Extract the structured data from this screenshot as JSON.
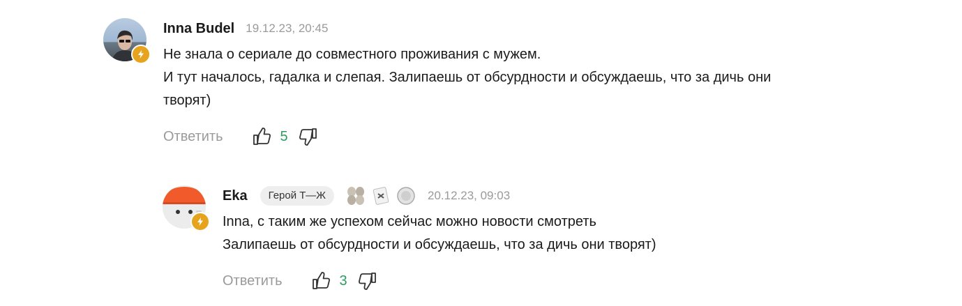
{
  "comments": [
    {
      "author": "Inna Budel",
      "date": "19.12.23, 20:45",
      "lines": [
        "Не знала о сериале до совместного проживания с мужем.",
        "И тут началось, гадалка и слепая. Залипаешь от обсурдности и обсуждаешь, что за дичь они",
        "творят)"
      ],
      "reply_label": "Ответить",
      "likes": "5"
    },
    {
      "author": "Eka",
      "role_badge": "Герой Т—Ж",
      "date": "20.12.23, 09:03",
      "lines": [
        "Inna, с таким же успехом сейчас можно новости смотреть",
        "Залипаешь от обсурдности и обсуждаешь, что за дичь они творят)"
      ],
      "reply_label": "Ответить",
      "likes": "3"
    }
  ],
  "colors": {
    "like_count": "#2a9d5c",
    "muted": "#9a9a9a",
    "badge_orange": "#e6a31e"
  },
  "icons": [
    "thumb-up-icon",
    "thumb-down-icon",
    "lightning-badge-icon",
    "award-icon"
  ]
}
